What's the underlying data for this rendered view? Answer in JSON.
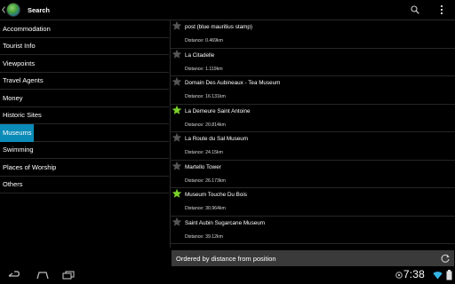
{
  "actionbar": {
    "title": "Search",
    "search_icon": "search-icon",
    "overflow_icon": "overflow-menu-icon"
  },
  "categories": [
    {
      "label": "Accommodation",
      "selected": false
    },
    {
      "label": "Tourist Info",
      "selected": false
    },
    {
      "label": "Viewpoints",
      "selected": false
    },
    {
      "label": "Travel Agents",
      "selected": false
    },
    {
      "label": "Money",
      "selected": false
    },
    {
      "label": "Historic Sites",
      "selected": false
    },
    {
      "label": "Museums",
      "selected": true
    },
    {
      "label": "Swimming",
      "selected": false
    },
    {
      "label": "Places of Worship",
      "selected": false
    },
    {
      "label": "Others",
      "selected": false
    }
  ],
  "places": [
    {
      "name": "post (blue mauritius stamp)",
      "distance": "Distance: 0.469km",
      "starred": false
    },
    {
      "name": "La Citadelle",
      "distance": "Distance: 1.119km",
      "starred": false
    },
    {
      "name": "Domain Des Aubineaux - Tea Museum",
      "distance": "Distance: 16.131km",
      "starred": false
    },
    {
      "name": "La Demeure Saint Antoine",
      "distance": "Distance: 20.814km",
      "starred": true
    },
    {
      "name": "La Route du Sal Museum",
      "distance": "Distance: 24.15km",
      "starred": false
    },
    {
      "name": "Martello Tower",
      "distance": "Distance: 26.173km",
      "starred": false
    },
    {
      "name": "Museum Touche Du Bois",
      "distance": "Distance: 30.964km",
      "starred": true
    },
    {
      "name": "Saint Aubin Sugarcane Museum",
      "distance": "Distance: 39.12km",
      "starred": false
    }
  ],
  "footer": {
    "label": "Ordered by distance from position"
  },
  "statusbar": {
    "time": "7:38"
  },
  "colors": {
    "selected": "#0b8bb8",
    "star_on": "#7bd22a",
    "star_off": "#555555",
    "footer_bg": "#3a3a3a"
  }
}
